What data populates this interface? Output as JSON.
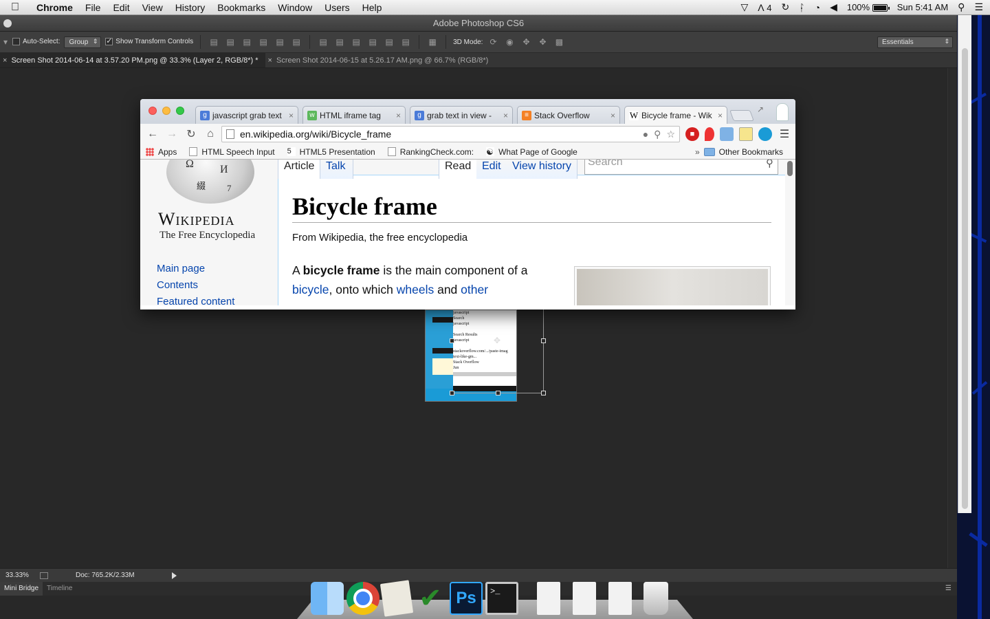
{
  "menubar": {
    "app_name": "Chrome",
    "items": [
      "File",
      "Edit",
      "View",
      "History",
      "Bookmarks",
      "Window",
      "Users",
      "Help"
    ],
    "status": {
      "adobe_count": "4",
      "battery": "100%",
      "clock": "Sun 5:41 AM"
    }
  },
  "photoshop": {
    "title": "Adobe Photoshop CS6",
    "options": {
      "auto_select_label": "Auto-Select:",
      "auto_select_value": "Group",
      "show_transform_label": "Show Transform Controls",
      "three_d_mode_label": "3D Mode:",
      "workspace": "Essentials"
    },
    "doc_tabs": [
      {
        "label": "Screen Shot 2014-06-14 at 3.57.20 PM.png @ 33.3% (Layer 2, RGB/8*) *"
      },
      {
        "label": "Screen Shot 2014-06-15 at 5.26.17 AM.png @ 66.7% (RGB/8*)"
      }
    ],
    "doc_image_text": [
      "javascript",
      "Search",
      "javascript",
      "Search Results",
      "javascript",
      "stackoverflow.com/.../paste-imag",
      "text-like-gm...",
      "Stack Overflow",
      "Jun"
    ],
    "status": {
      "zoom": "33.33%",
      "doc": "Doc: 765.2K/2.33M"
    },
    "panels": [
      "Mini Bridge",
      "Timeline"
    ]
  },
  "chrome": {
    "tabs": [
      {
        "title": "javascript grab text",
        "favicon": "g",
        "color": "#4a7bd8"
      },
      {
        "title": "HTML iframe tag",
        "favicon": "w3",
        "color": "#5cb85c"
      },
      {
        "title": "grab text in view -",
        "favicon": "g",
        "color": "#4a7bd8"
      },
      {
        "title": "Stack Overflow",
        "favicon": "so",
        "color": "#f48024"
      },
      {
        "title": "Bicycle frame - Wik",
        "favicon": "W",
        "color": "#ffffff"
      }
    ],
    "url": "en.wikipedia.org/wiki/Bicycle_frame",
    "bookmarks": [
      "Apps",
      "HTML Speech Input",
      "HTML5 Presentation",
      "RankingCheck.com:",
      "What Page of Google"
    ],
    "bookmarks_more": "»",
    "other_bookmarks": "Other Bookmarks"
  },
  "wikipedia": {
    "wordmark": "Wikipedia",
    "tagline": "The Free Encyclopedia",
    "nav": [
      "Main page",
      "Contents",
      "Featured content"
    ],
    "tabs": {
      "article": "Article",
      "talk": "Talk",
      "read": "Read",
      "edit": "Edit",
      "view_history": "View history"
    },
    "search_placeholder": "Search",
    "title": "Bicycle frame",
    "from": "From Wikipedia, the free encyclopedia",
    "para": {
      "pre": "A ",
      "bold": "bicycle frame",
      "mid": " is the main component of a ",
      "link1": "bicycle",
      "mid2": ", onto which ",
      "link2": "wheels",
      "mid3": " and ",
      "link3": "other"
    }
  },
  "dock": {
    "items": [
      "finder",
      "chrome",
      "preview",
      "tasks",
      "photoshop",
      "terminal",
      "document",
      "document",
      "document",
      "trash"
    ],
    "ps_label": "Ps",
    "terminal_label": ">_"
  }
}
